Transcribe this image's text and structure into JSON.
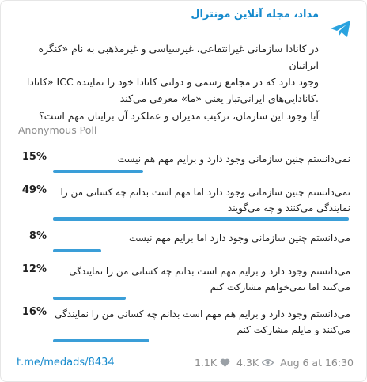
{
  "header": {
    "channel_name": "مداد، مجله آنلاین مونترال",
    "logo_icon": "telegram-logo-icon"
  },
  "post": {
    "body_lines": [
      "در کانادا سازمانی غیرانتفاعی، غیرسیاسی و غیرمذهبی به نام «کنگره ایرانیان",
      "وجود دارد که در مجامع رسمی و دولتی کانادا خود را نماینده ICC «کانادا",
      ".کانادایی‌های ایرانی‌تبار یعنی «ما» معرفی می‌کند"
    ],
    "question": "آیا وجود این سازمان، ترکیب مدیران و عملکرد آن برایتان مهم است؟",
    "poll_type": "Anonymous Poll"
  },
  "poll": {
    "options": [
      {
        "percent_label": "15%",
        "percent": 15,
        "text": "نمی‌دانستم چنین سازمانی وجود دارد و برایم مهم هم نیست"
      },
      {
        "percent_label": "49%",
        "percent": 49,
        "text": "نمی‌دانستم چنین سازمانی وجود دارد اما مهم است بدانم چه کسانی من را نمایندگی می‌کنند و چه می‌گویند"
      },
      {
        "percent_label": "8%",
        "percent": 8,
        "text": "می‌دانستم چنین سازمانی وجود دارد اما برایم مهم نیست"
      },
      {
        "percent_label": "12%",
        "percent": 12,
        "text": "می‌دانستم وجود دارد و برایم مهم است بدانم چه کسانی من را نمایندگی می‌کنند اما نمی‌خواهم مشارکت کنم"
      },
      {
        "percent_label": "16%",
        "percent": 16,
        "text": "می‌دانستم وجود دارد و برایم هم مهم است بدانم چه کسانی من را نمایندگی می‌کنند و مایلم مشارکت کنم"
      }
    ],
    "accent_color": "#3a9ed8"
  },
  "footer": {
    "link": "t.me/medads/8434",
    "reactions": "1.1K",
    "views": "4.3K",
    "date": "Aug 6 at 16:30",
    "reaction_icon": "heart-icon",
    "views_icon": "eye-icon"
  }
}
